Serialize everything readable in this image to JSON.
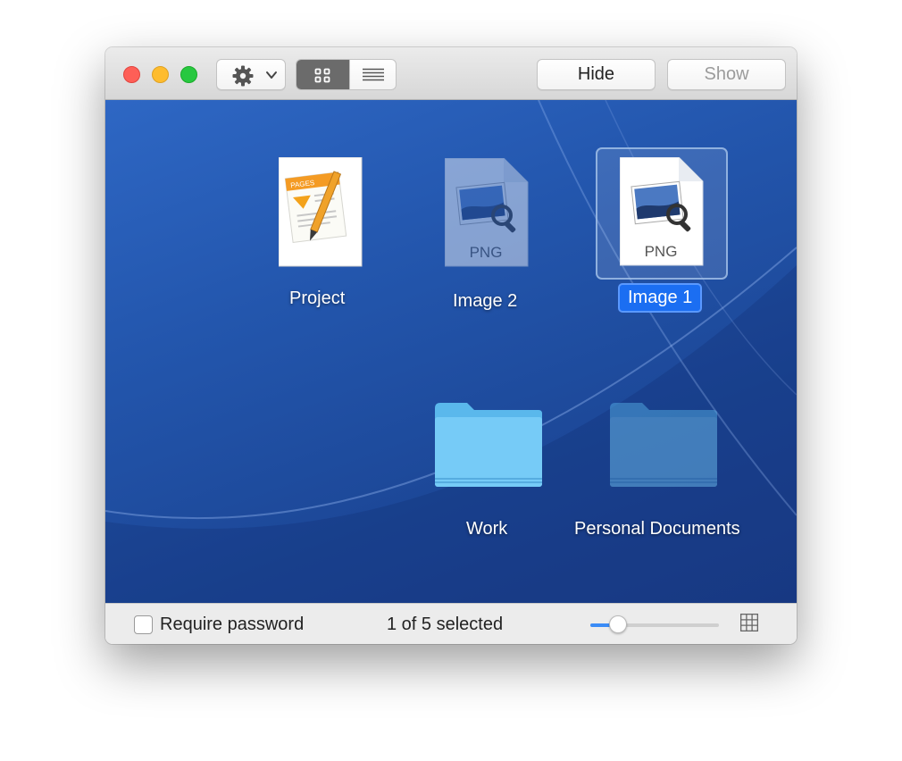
{
  "toolbar": {
    "gear_icon": "gear-icon",
    "view_modes": [
      "grid-view-icon",
      "list-view-icon"
    ],
    "active_view": "grid",
    "hide_label": "Hide",
    "show_label": "Show",
    "show_enabled": false
  },
  "items": [
    {
      "label": "Project",
      "kind": "pages-document",
      "selected": false
    },
    {
      "label": "Image 2",
      "kind": "png-image",
      "badge": "PNG",
      "selected": false,
      "dimmed": true
    },
    {
      "label": "Image 1",
      "kind": "png-image",
      "badge": "PNG",
      "selected": true
    },
    {
      "label": "Work",
      "kind": "folder",
      "selected": false
    },
    {
      "label": "Personal Documents",
      "kind": "folder",
      "selected": false,
      "dimmed": true
    }
  ],
  "footer": {
    "require_password_label": "Require password",
    "require_password_checked": false,
    "selection_status": "1 of 5 selected",
    "icon_size_slider": 0.17
  },
  "colors": {
    "selection": "#1b6ef2",
    "slider_fill": "#3b8cf6",
    "close": "#fe5f57",
    "minimize": "#febc2e",
    "zoom": "#28c840"
  }
}
